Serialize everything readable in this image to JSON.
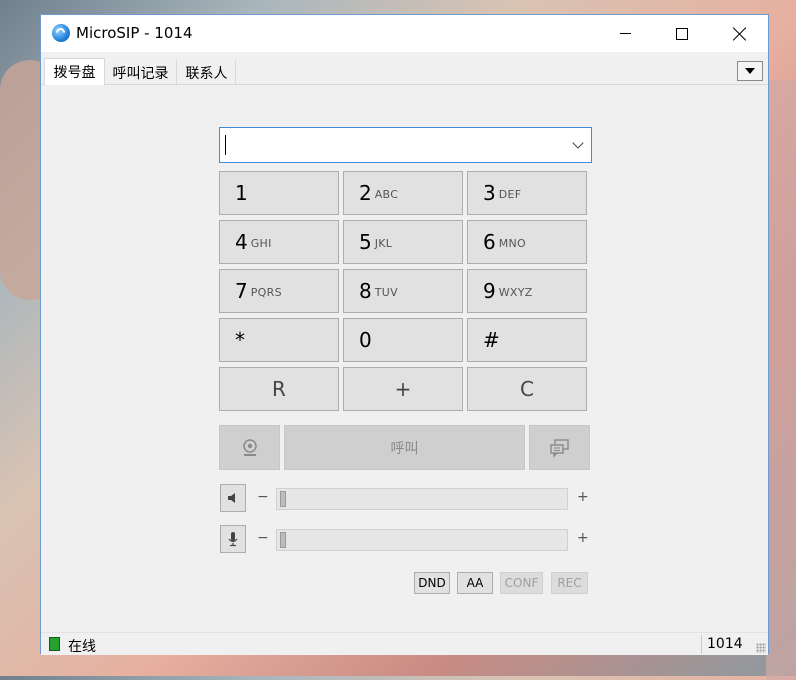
{
  "window": {
    "title": "MicroSIP - 1014",
    "icon": "microsip-app-icon"
  },
  "tabs": [
    {
      "label": "拨号盘",
      "active": true
    },
    {
      "label": "呼叫记录",
      "active": false
    },
    {
      "label": "联系人",
      "active": false
    }
  ],
  "dial_input": {
    "value": "",
    "placeholder": ""
  },
  "keypad": {
    "keys": [
      {
        "digit": "1",
        "letters": ""
      },
      {
        "digit": "2",
        "letters": "ABC"
      },
      {
        "digit": "3",
        "letters": "DEF"
      },
      {
        "digit": "4",
        "letters": "GHI"
      },
      {
        "digit": "5",
        "letters": "JKL"
      },
      {
        "digit": "6",
        "letters": "MNO"
      },
      {
        "digit": "7",
        "letters": "PQRS"
      },
      {
        "digit": "8",
        "letters": "TUV"
      },
      {
        "digit": "9",
        "letters": "WXYZ"
      },
      {
        "digit": "*",
        "letters": ""
      },
      {
        "digit": "0",
        "letters": ""
      },
      {
        "digit": "#",
        "letters": ""
      }
    ],
    "function_keys": [
      "R",
      "+",
      "C"
    ]
  },
  "actions": {
    "call_label": "呼叫",
    "video_icon": "webcam-icon",
    "message_icon": "chat-bubbles-icon"
  },
  "volume": {
    "speaker": {
      "icon": "speaker-icon",
      "minus": "−",
      "plus": "+",
      "level": 0
    },
    "microphone": {
      "icon": "microphone-icon",
      "minus": "−",
      "plus": "+",
      "level": 0
    }
  },
  "toggles": [
    {
      "label": "DND",
      "enabled": true
    },
    {
      "label": "AA",
      "enabled": true
    },
    {
      "label": "CONF",
      "enabled": false
    },
    {
      "label": "REC",
      "enabled": false
    }
  ],
  "status": {
    "text": "在线",
    "account": "1014",
    "color": "#27a12e"
  },
  "colors": {
    "input_border": "#3c8fd6",
    "window_border": "#6b9bd1"
  }
}
